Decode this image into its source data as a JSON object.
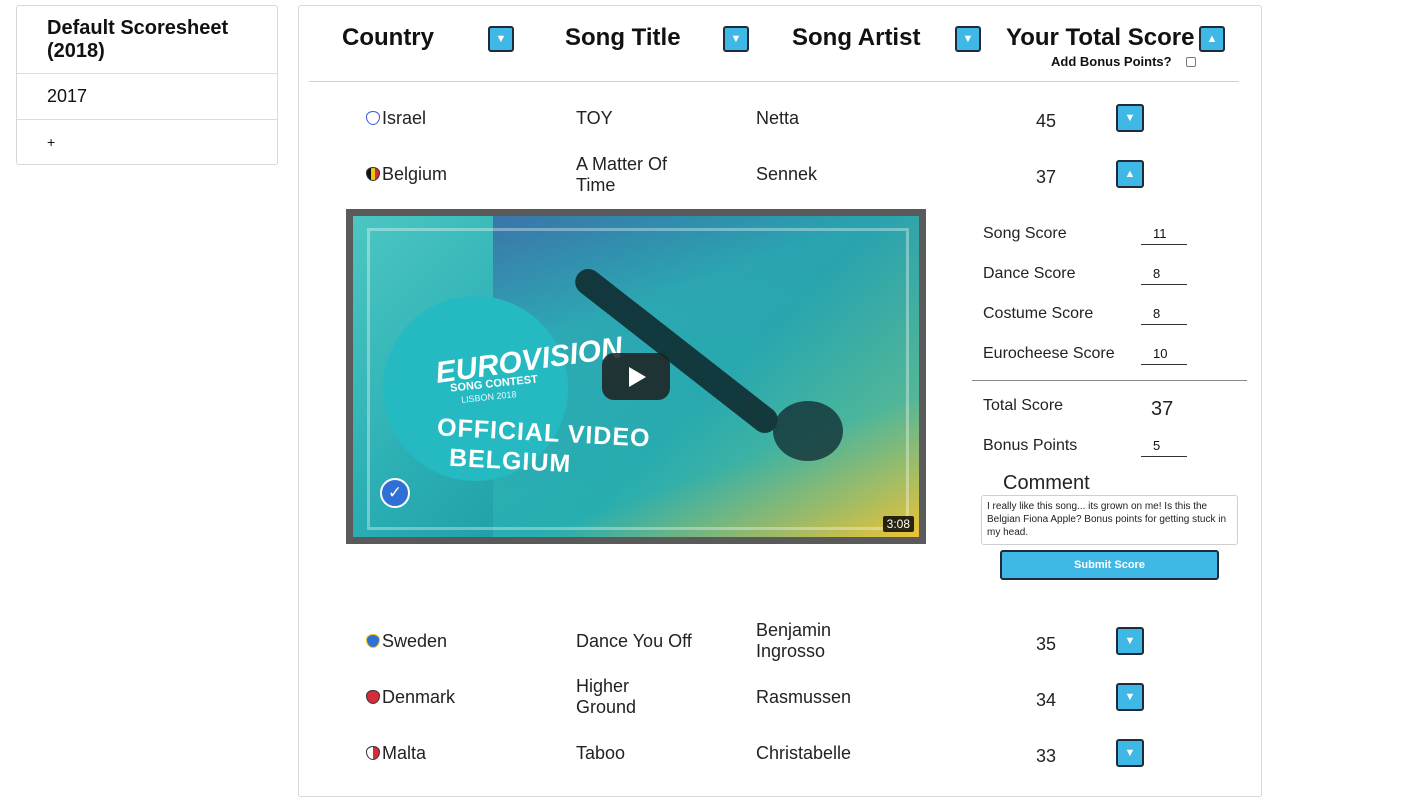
{
  "sidebar": {
    "items": [
      {
        "label": "Default Scoresheet (2018)"
      },
      {
        "label": "2017"
      },
      {
        "label": "+"
      }
    ]
  },
  "header": {
    "country": "Country",
    "song_title": "Song Title",
    "song_artist": "Song Artist",
    "total_score": "Your Total Score",
    "bonus_label": "Add Bonus Points?",
    "sort_down_icon": "▼",
    "sort_up_icon": "▲"
  },
  "rows": [
    {
      "country": "Israel",
      "title": "TOY",
      "artist": "Netta",
      "score": "45",
      "expanded": false,
      "flag_color": "#3a5bd9"
    },
    {
      "country": "Belgium",
      "title": "A Matter Of Time",
      "artist": "Sennek",
      "score": "37",
      "expanded": true,
      "flag_color": "#f2c511"
    },
    {
      "country": "Sweden",
      "title": "Dance You Off",
      "artist": "Benjamin Ingrosso",
      "score": "35",
      "expanded": false,
      "flag_color": "#2f6fd6"
    },
    {
      "country": "Denmark",
      "title": "Higher Ground",
      "artist": "Rasmussen",
      "score": "34",
      "expanded": false,
      "flag_color": "#d62b3b"
    },
    {
      "country": "Malta",
      "title": "Taboo",
      "artist": "Christabelle",
      "score": "33",
      "expanded": false,
      "flag_color": "#d62b3b"
    }
  ],
  "video": {
    "logo_text": "EUROVISION",
    "logo_sub": "SONG CONTEST",
    "logo_sub2": "LISBON 2018",
    "title_line1": "OFFICIAL VIDEO",
    "title_line2": "BELGIUM",
    "duration": "3:08",
    "check_icon": "✓"
  },
  "breakdown": {
    "song_label": "Song Score",
    "song_value": "11",
    "dance_label": "Dance Score",
    "dance_value": "8",
    "costume_label": "Costume Score",
    "costume_value": "8",
    "eurocheese_label": "Eurocheese Score",
    "eurocheese_value": "10",
    "total_label": "Total Score",
    "total_value": "37",
    "bonus_label": "Bonus Points",
    "bonus_value": "5",
    "comment_label": "Comment",
    "comment_text": "I really like this song... its grown on me! Is this the Belgian Fiona Apple? Bonus points for getting stuck in my head.",
    "submit_label": "Submit Score"
  },
  "colors": {
    "accent": "#3fb8e6",
    "button_border": "#1f2b3a"
  }
}
